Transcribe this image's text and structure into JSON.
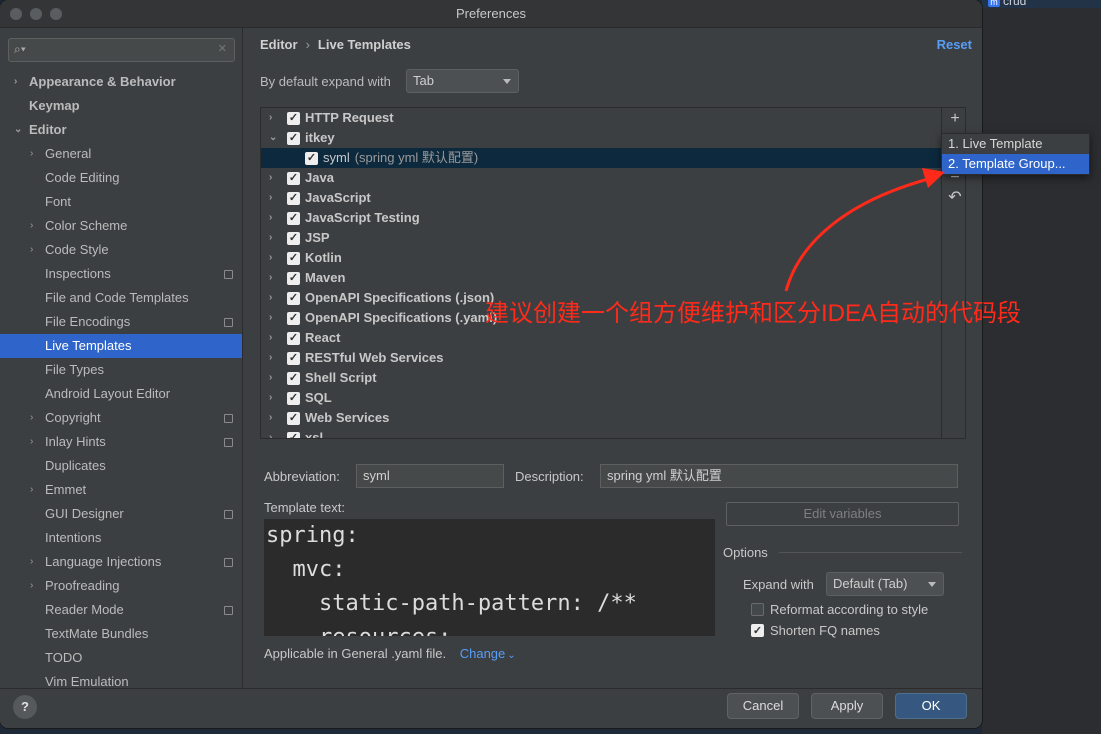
{
  "window": {
    "title": "Preferences"
  },
  "background": {
    "peek_text": "crud",
    "peek_badge": "m"
  },
  "search": {
    "placeholder": "",
    "icon": "search-icon"
  },
  "sidebar": {
    "items": [
      {
        "label": "Appearance & Behavior",
        "level": 0,
        "bold": true,
        "arrow": "›"
      },
      {
        "label": "Keymap",
        "level": 0,
        "bold": true
      },
      {
        "label": "Editor",
        "level": 0,
        "bold": true,
        "arrow": "⌄"
      },
      {
        "label": "General",
        "level": 1,
        "arrow": "›"
      },
      {
        "label": "Code Editing",
        "level": 1
      },
      {
        "label": "Font",
        "level": 1
      },
      {
        "label": "Color Scheme",
        "level": 1,
        "arrow": "›"
      },
      {
        "label": "Code Style",
        "level": 1,
        "arrow": "›"
      },
      {
        "label": "Inspections",
        "level": 1,
        "badge": true
      },
      {
        "label": "File and Code Templates",
        "level": 1
      },
      {
        "label": "File Encodings",
        "level": 1,
        "badge": true
      },
      {
        "label": "Live Templates",
        "level": 1,
        "selected": true
      },
      {
        "label": "File Types",
        "level": 1
      },
      {
        "label": "Android Layout Editor",
        "level": 1
      },
      {
        "label": "Copyright",
        "level": 1,
        "arrow": "›",
        "badge": true
      },
      {
        "label": "Inlay Hints",
        "level": 1,
        "arrow": "›",
        "badge": true
      },
      {
        "label": "Duplicates",
        "level": 1
      },
      {
        "label": "Emmet",
        "level": 1,
        "arrow": "›"
      },
      {
        "label": "GUI Designer",
        "level": 1,
        "badge": true
      },
      {
        "label": "Intentions",
        "level": 1
      },
      {
        "label": "Language Injections",
        "level": 1,
        "arrow": "›",
        "badge": true
      },
      {
        "label": "Proofreading",
        "level": 1,
        "arrow": "›"
      },
      {
        "label": "Reader Mode",
        "level": 1,
        "badge": true
      },
      {
        "label": "TextMate Bundles",
        "level": 1
      },
      {
        "label": "TODO",
        "level": 1
      },
      {
        "label": "Vim Emulation",
        "level": 1
      }
    ]
  },
  "header": {
    "crumb1": "Editor",
    "separator": "›",
    "crumb2": "Live Templates",
    "reset": "Reset"
  },
  "expand_default": {
    "label": "By default expand with",
    "value": "Tab"
  },
  "templates": [
    {
      "label": "HTTP Request",
      "arrow": "›",
      "checked": true
    },
    {
      "label": "itkey",
      "arrow": "⌄",
      "checked": true
    },
    {
      "label": "syml",
      "desc": "(spring yml 默认配置)",
      "checked": true,
      "child": true
    },
    {
      "label": "Java",
      "arrow": "›",
      "checked": true
    },
    {
      "label": "JavaScript",
      "arrow": "›",
      "checked": true
    },
    {
      "label": "JavaScript Testing",
      "arrow": "›",
      "checked": true
    },
    {
      "label": "JSP",
      "arrow": "›",
      "checked": true
    },
    {
      "label": "Kotlin",
      "arrow": "›",
      "checked": true
    },
    {
      "label": "Maven",
      "arrow": "›",
      "checked": true
    },
    {
      "label": "OpenAPI Specifications (.json)",
      "arrow": "›",
      "checked": true
    },
    {
      "label": "OpenAPI Specifications (.yaml)",
      "arrow": "›",
      "checked": true
    },
    {
      "label": "React",
      "arrow": "›",
      "checked": true
    },
    {
      "label": "RESTful Web Services",
      "arrow": "›",
      "checked": true
    },
    {
      "label": "Shell Script",
      "arrow": "›",
      "checked": true
    },
    {
      "label": "SQL",
      "arrow": "›",
      "checked": true
    },
    {
      "label": "Web Services",
      "arrow": "›",
      "checked": true
    },
    {
      "label": "xsl",
      "arrow": "›",
      "checked": true
    }
  ],
  "toolbar": {
    "add": "+",
    "remove": "−",
    "revert": "↶"
  },
  "popup": {
    "items": [
      "1. Live Template",
      "2. Template Group..."
    ]
  },
  "abbreviation": {
    "label": "Abbreviation:",
    "value": "syml"
  },
  "description": {
    "label": "Description:",
    "value": "spring yml 默认配置"
  },
  "template_text": {
    "label": "Template text:",
    "lines": [
      "spring:",
      "  mvc:",
      "    static-path-pattern: /**",
      "    resources:"
    ]
  },
  "edit_variables": "Edit variables",
  "options": {
    "title": "Options",
    "expand_label": "Expand with",
    "expand_value": "Default (Tab)",
    "reformat": {
      "label": "Reformat according to style",
      "checked": false
    },
    "shorten": {
      "label": "Shorten FQ names",
      "checked": true
    }
  },
  "applicable": {
    "text": "Applicable in General .yaml file.",
    "link": "Change",
    "link_caret": "⌄"
  },
  "footer": {
    "help": "?",
    "cancel": "Cancel",
    "apply": "Apply",
    "ok": "OK"
  },
  "annotation": {
    "text": "建议创建一个组方便维护和区分IDEA自动的代码段",
    "color": "#ff2a1a"
  },
  "colors": {
    "accent": "#2f65ca",
    "link": "#589df6",
    "annotation": "#ff2a1a"
  }
}
